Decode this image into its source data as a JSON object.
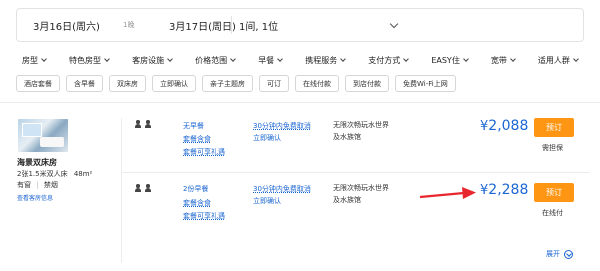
{
  "search": {
    "checkin": "3月16日(周六)",
    "nights": "1晚",
    "checkout": "3月17日(周日)",
    "rooms_guests": "1间, 1位"
  },
  "filters": [
    "房型",
    "特色房型",
    "客房设施",
    "价格范围",
    "早餐",
    "携程服务",
    "支付方式",
    "EASY住",
    "宽带",
    "适用人群"
  ],
  "tags": [
    "酒店套餐",
    "含早餐",
    "双床房",
    "立即确认",
    "亲子主题房",
    "可订",
    "在线付款",
    "到店付款",
    "免费Wi-Fi上网"
  ],
  "room": {
    "name": "海景双床房",
    "spec": "2张1.5米双人床",
    "area": "48m²",
    "window": "有窗",
    "smoking": "禁烟",
    "info_link": "查看客房信息"
  },
  "offers": [
    {
      "meal": "无早餐",
      "perks": [
        "套餐含食",
        "套餐可享礼遇"
      ],
      "cancel": "30分钟内免费取消",
      "confirm": "立即确认",
      "promo": "无限次畅玩水世界及水族馆",
      "price_symbol": "¥",
      "price": "2,088",
      "book": "预订",
      "pay": "需担保"
    },
    {
      "meal": "2份早餐",
      "perks": [
        "套餐含食",
        "套餐可享礼遇"
      ],
      "cancel": "30分钟内免费取消",
      "confirm": "立即确认",
      "promo": "无限次畅玩水世界及水族馆",
      "price_symbol": "¥",
      "price": "2,288",
      "book": "预订",
      "pay": "在线付"
    }
  ],
  "expand_label": "展开",
  "colors": {
    "accent_blue": "#1b66d1",
    "book_orange": "#ff9613",
    "arrow_red": "#e8262d"
  }
}
